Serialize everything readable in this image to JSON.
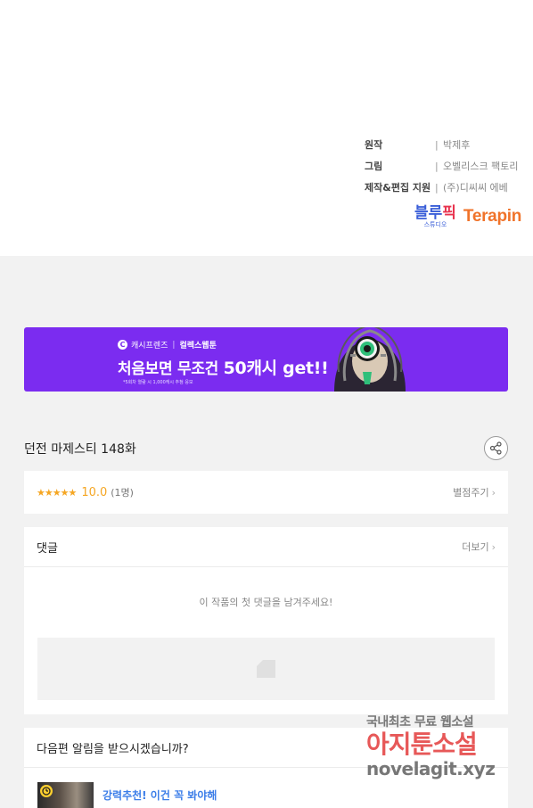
{
  "credits": [
    {
      "role": "원작",
      "sep": "|",
      "name": "박제후"
    },
    {
      "role": "그림",
      "sep": "|",
      "name": "오벨리스크 팩토리"
    },
    {
      "role": "제작&편집 지원",
      "sep": "|",
      "name": "(주)디씨씨 에베"
    }
  ],
  "logos": {
    "bluepick_main": "블루",
    "bluepick_accent": "픽",
    "bluepick_sub": "스튜디오",
    "terapin": "Terapin"
  },
  "banner": {
    "icon_letter": "C",
    "brand": "캐시프렌즈",
    "bar": "|",
    "partner": "컬렉스웹툰",
    "headline_pre": "처음보면 무조건 ",
    "headline_big": "50캐시 get!!",
    "note": "*5회차 열람 시 1,000캐시 추첨 응모"
  },
  "episode": {
    "title": "던전 마제스티 148화"
  },
  "rating": {
    "stars": "★★★★★",
    "score": "10.0",
    "count": "(1명)",
    "rate_link": "별점주기",
    "chevron": "›"
  },
  "comments": {
    "title": "댓글",
    "more_link": "더보기",
    "chevron": "›",
    "empty_message": "이 작품의 첫 댓글을 남겨주세요!"
  },
  "notify": {
    "question": "다음편 알림을 받으시겠습니까?",
    "recommend_text": "강력추천! 이건 꼭 봐야해"
  },
  "watermark": {
    "line1": "국내최초 무료 웹소설",
    "line2": "아지툰소설",
    "line3": "novelagit.xyz"
  },
  "colors": {
    "banner_bg": "#7b2cf0",
    "star": "#f5a623",
    "link_blue": "#3b7de8",
    "terapin": "#f0732a",
    "bluepick": "#3b5fd8"
  },
  "icons": [
    "share-icon",
    "chevron-right-icon",
    "clock-icon",
    "comment-placeholder-icon",
    "cash-c-icon"
  ]
}
